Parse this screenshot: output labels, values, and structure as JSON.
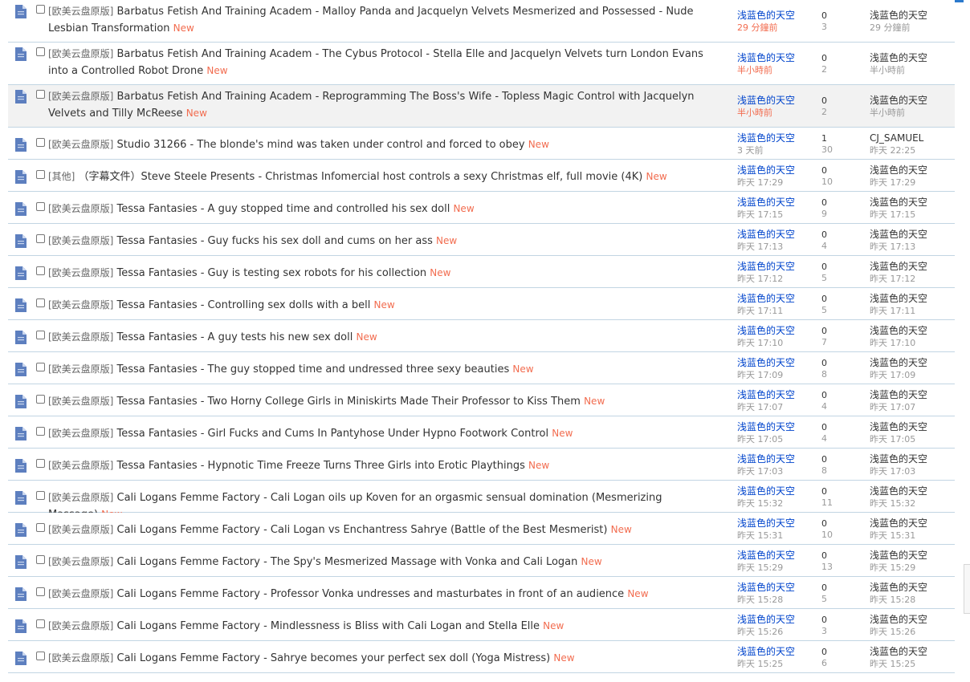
{
  "colors": {
    "accent": "#2b7acd",
    "author_blue": "#0044cc",
    "new_orange": "#f26c4f",
    "row_divider": "#c2d5e3"
  },
  "thread_icon": "document-icon",
  "threads": [
    {
      "category": "[欧美云盘原版]",
      "title": "Barbatus Fetish And Training Academ - Malloy Panda and Jacquelyn Velvets Mesmerized and Possessed - Nude Lesbian Transformation",
      "new": "New",
      "author": "浅蓝色的天空",
      "post_time": "29 分鐘前",
      "replies": "0",
      "views": "3",
      "last_poster": "浅蓝色的天空",
      "last_time": "29 分鐘前",
      "tall": true,
      "recent": true,
      "highlight": false
    },
    {
      "category": "[欧美云盘原版]",
      "title": "Barbatus Fetish And Training Academ - The Cybus Protocol - Stella Elle and Jacquelyn Velvets turn London Evans into a Controlled Robot Drone",
      "new": "New",
      "author": "浅蓝色的天空",
      "post_time": "半小時前",
      "replies": "0",
      "views": "2",
      "last_poster": "浅蓝色的天空",
      "last_time": "半小時前",
      "tall": true,
      "recent": true,
      "highlight": false
    },
    {
      "category": "[欧美云盘原版]",
      "title": "Barbatus Fetish And Training Academ - Reprogramming The Boss's Wife - Topless Magic Control with Jacquelyn Velvets and Tilly McReese",
      "new": "New",
      "author": "浅蓝色的天空",
      "post_time": "半小時前",
      "replies": "0",
      "views": "2",
      "last_poster": "浅蓝色的天空",
      "last_time": "半小時前",
      "tall": true,
      "recent": true,
      "highlight": true
    },
    {
      "category": "[欧美云盘原版]",
      "title": "Studio 31266 - The blonde's mind was taken under control and forced to obey",
      "new": "New",
      "author": "浅蓝色的天空",
      "post_time": "3 天前",
      "replies": "1",
      "views": "30",
      "last_poster": "CJ_SAMUEL",
      "last_time": "昨天 22:25",
      "tall": false,
      "recent": false,
      "highlight": false
    },
    {
      "category": "[其他]",
      "title": "（字幕文件）Steve Steele Presents - Christmas Infomercial host controls a sexy Christmas elf, full movie (4K)",
      "new": "New",
      "author": "浅蓝色的天空",
      "post_time": "昨天 17:29",
      "replies": "0",
      "views": "10",
      "last_poster": "浅蓝色的天空",
      "last_time": "昨天 17:29",
      "tall": false,
      "recent": false,
      "highlight": false
    },
    {
      "category": "[欧美云盘原版]",
      "title": "Tessa Fantasies - A guy stopped time and controlled his sex doll",
      "new": "New",
      "author": "浅蓝色的天空",
      "post_time": "昨天 17:15",
      "replies": "0",
      "views": "9",
      "last_poster": "浅蓝色的天空",
      "last_time": "昨天 17:15",
      "tall": false,
      "recent": false,
      "highlight": false
    },
    {
      "category": "[欧美云盘原版]",
      "title": "Tessa Fantasies - Guy fucks his sex doll and cums on her ass",
      "new": "New",
      "author": "浅蓝色的天空",
      "post_time": "昨天 17:13",
      "replies": "0",
      "views": "4",
      "last_poster": "浅蓝色的天空",
      "last_time": "昨天 17:13",
      "tall": false,
      "recent": false,
      "highlight": false
    },
    {
      "category": "[欧美云盘原版]",
      "title": "Tessa Fantasies - Guy is testing sex robots for his collection",
      "new": "New",
      "author": "浅蓝色的天空",
      "post_time": "昨天 17:12",
      "replies": "0",
      "views": "5",
      "last_poster": "浅蓝色的天空",
      "last_time": "昨天 17:12",
      "tall": false,
      "recent": false,
      "highlight": false
    },
    {
      "category": "[欧美云盘原版]",
      "title": "Tessa Fantasies - Controlling sex dolls with a bell",
      "new": "New",
      "author": "浅蓝色的天空",
      "post_time": "昨天 17:11",
      "replies": "0",
      "views": "5",
      "last_poster": "浅蓝色的天空",
      "last_time": "昨天 17:11",
      "tall": false,
      "recent": false,
      "highlight": false
    },
    {
      "category": "[欧美云盘原版]",
      "title": "Tessa Fantasies - A guy tests his new sex doll",
      "new": "New",
      "author": "浅蓝色的天空",
      "post_time": "昨天 17:10",
      "replies": "0",
      "views": "7",
      "last_poster": "浅蓝色的天空",
      "last_time": "昨天 17:10",
      "tall": false,
      "recent": false,
      "highlight": false
    },
    {
      "category": "[欧美云盘原版]",
      "title": "Tessa Fantasies - The guy stopped time and undressed three sexy beauties",
      "new": "New",
      "author": "浅蓝色的天空",
      "post_time": "昨天 17:09",
      "replies": "0",
      "views": "8",
      "last_poster": "浅蓝色的天空",
      "last_time": "昨天 17:09",
      "tall": false,
      "recent": false,
      "highlight": false
    },
    {
      "category": "[欧美云盘原版]",
      "title": "Tessa Fantasies - Two Horny College Girls in Miniskirts Made Their Professor to Kiss Them",
      "new": "New",
      "author": "浅蓝色的天空",
      "post_time": "昨天 17:07",
      "replies": "0",
      "views": "4",
      "last_poster": "浅蓝色的天空",
      "last_time": "昨天 17:07",
      "tall": false,
      "recent": false,
      "highlight": false
    },
    {
      "category": "[欧美云盘原版]",
      "title": "Tessa Fantasies - Girl Fucks and Cums In Pantyhose Under Hypno Footwork Control",
      "new": "New",
      "author": "浅蓝色的天空",
      "post_time": "昨天 17:05",
      "replies": "0",
      "views": "4",
      "last_poster": "浅蓝色的天空",
      "last_time": "昨天 17:05",
      "tall": false,
      "recent": false,
      "highlight": false
    },
    {
      "category": "[欧美云盘原版]",
      "title": "Tessa Fantasies - Hypnotic Time Freeze Turns Three Girls into Erotic Playthings",
      "new": "New",
      "author": "浅蓝色的天空",
      "post_time": "昨天 17:03",
      "replies": "0",
      "views": "8",
      "last_poster": "浅蓝色的天空",
      "last_time": "昨天 17:03",
      "tall": false,
      "recent": false,
      "highlight": false
    },
    {
      "category": "[欧美云盘原版]",
      "title": "Cali Logans Femme Factory - Cali Logan oils up Koven for an orgasmic sensual domination (Mesmerizing Massage)",
      "new": "New",
      "author": "浅蓝色的天空",
      "post_time": "昨天 15:32",
      "replies": "0",
      "views": "11",
      "last_poster": "浅蓝色的天空",
      "last_time": "昨天 15:32",
      "tall": false,
      "recent": false,
      "highlight": false
    },
    {
      "category": "[欧美云盘原版]",
      "title": "Cali Logans Femme Factory - Cali Logan vs Enchantress Sahrye (Battle of the Best Mesmerist)",
      "new": "New",
      "author": "浅蓝色的天空",
      "post_time": "昨天 15:31",
      "replies": "0",
      "views": "10",
      "last_poster": "浅蓝色的天空",
      "last_time": "昨天 15:31",
      "tall": false,
      "recent": false,
      "highlight": false
    },
    {
      "category": "[欧美云盘原版]",
      "title": "Cali Logans Femme Factory - The Spy's Mesmerized Massage with Vonka and Cali Logan",
      "new": "New",
      "author": "浅蓝色的天空",
      "post_time": "昨天 15:29",
      "replies": "0",
      "views": "13",
      "last_poster": "浅蓝色的天空",
      "last_time": "昨天 15:29",
      "tall": false,
      "recent": false,
      "highlight": false
    },
    {
      "category": "[欧美云盘原版]",
      "title": "Cali Logans Femme Factory - Professor Vonka undresses and masturbates in front of an audience",
      "new": "New",
      "author": "浅蓝色的天空",
      "post_time": "昨天 15:28",
      "replies": "0",
      "views": "5",
      "last_poster": "浅蓝色的天空",
      "last_time": "昨天 15:28",
      "tall": false,
      "recent": false,
      "highlight": false
    },
    {
      "category": "[欧美云盘原版]",
      "title": "Cali Logans Femme Factory - Mindlessness is Bliss with Cali Logan and Stella Elle",
      "new": "New",
      "author": "浅蓝色的天空",
      "post_time": "昨天 15:26",
      "replies": "0",
      "views": "3",
      "last_poster": "浅蓝色的天空",
      "last_time": "昨天 15:26",
      "tall": false,
      "recent": false,
      "highlight": false
    },
    {
      "category": "[欧美云盘原版]",
      "title": "Cali Logans Femme Factory - Sahrye becomes your perfect sex doll (Yoga Mistress)",
      "new": "New",
      "author": "浅蓝色的天空",
      "post_time": "昨天 15:25",
      "replies": "0",
      "views": "6",
      "last_poster": "浅蓝色的天空",
      "last_time": "昨天 15:25",
      "tall": false,
      "recent": false,
      "highlight": false
    }
  ]
}
